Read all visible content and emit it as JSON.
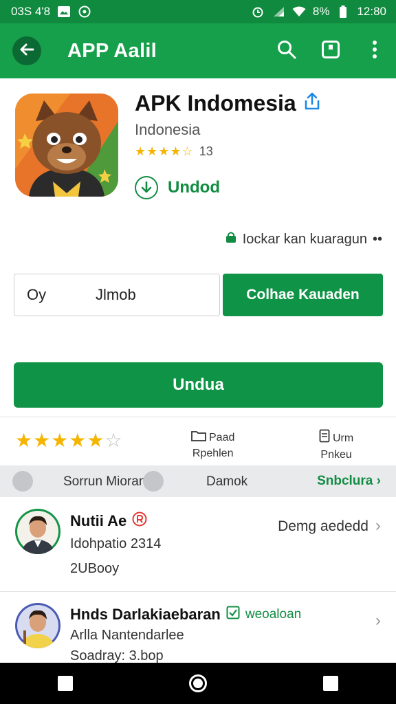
{
  "status_bar": {
    "left_text": "03S 4'8",
    "battery": "8%",
    "time": "12:80"
  },
  "app_bar": {
    "title": "APP Aalil"
  },
  "app": {
    "name": "APK Indomesia",
    "subtitle": "Indonesia",
    "rating_count": "13",
    "install_label": "Undod"
  },
  "note": {
    "text": "Iockar kan kuaragun"
  },
  "row_actions": {
    "outline_left": "Oy",
    "outline_right": "Jlmob",
    "green_label": "Colhae Kauaden"
  },
  "primary_button": {
    "label": "Undua"
  },
  "rating_section": {
    "col1_line1": "Paad",
    "col1_line2": "Rpehlen",
    "col2_line1": "Urm",
    "col2_line2": "Pnkeu"
  },
  "filter_bar": {
    "item1": "Sorrun Mioran",
    "item2": "Damok",
    "link": "Snbclura"
  },
  "list": [
    {
      "title": "Nutii Ae",
      "line1": "Idohpatio 2314",
      "line2": "2UBooy",
      "right": "Demg aededd"
    },
    {
      "title": "Hnds Darlakiaebaran",
      "badge": "weoaloan",
      "line1": "Arlla Nantendarlee",
      "line2": "Soadray: 3.bop"
    }
  ],
  "colors": {
    "primary": "#17a04b",
    "primary_dark": "#0f8a3e",
    "button_green": "#0f9346",
    "star": "#f5b400"
  },
  "icons": [
    "back-arrow-icon",
    "search-icon",
    "box-icon",
    "more-vert-icon",
    "share-icon",
    "download-icon",
    "chevron-right-icon"
  ]
}
